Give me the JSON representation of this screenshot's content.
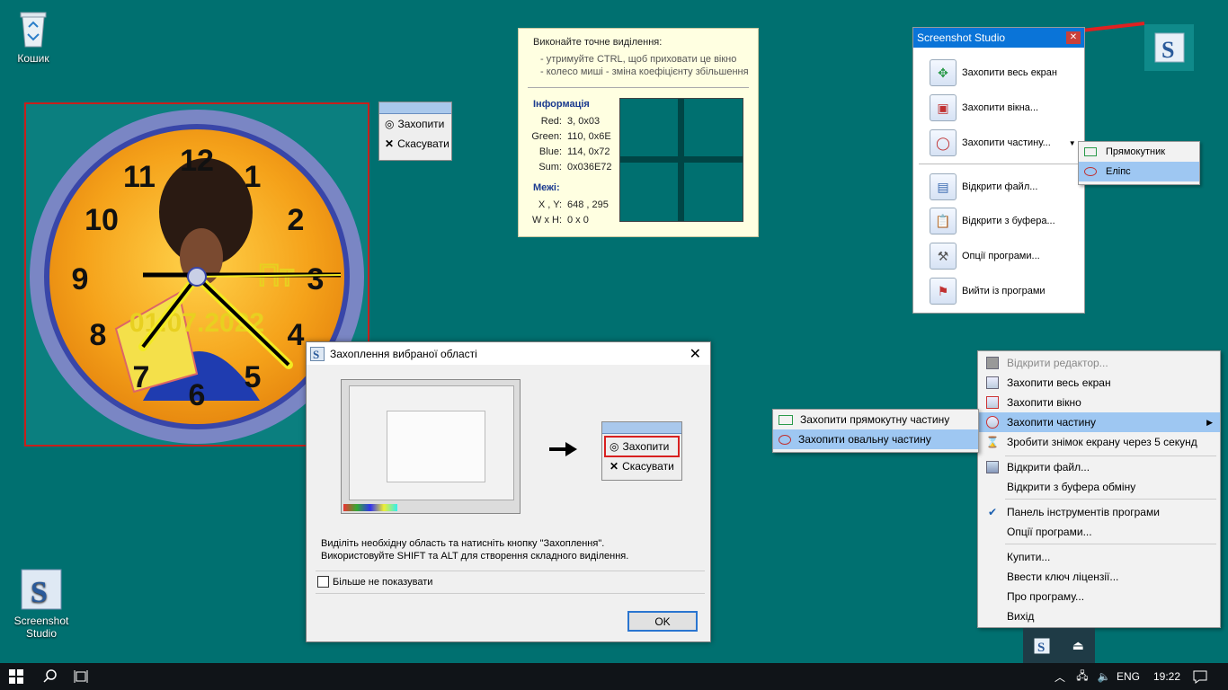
{
  "desktop": {
    "recycle_bin_label": "Кошик",
    "screenshot_studio_label_1": "Screenshot",
    "screenshot_studio_label_2": "Studio"
  },
  "clock": {
    "day": "Пт",
    "date": "01.07.2022",
    "numbers": [
      "12",
      "1",
      "2",
      "3",
      "4",
      "5",
      "6",
      "7",
      "8",
      "9",
      "10",
      "11"
    ]
  },
  "mini_panel": {
    "capture": "Захопити",
    "cancel": "Скасувати"
  },
  "info_panel": {
    "hint": "Виконайте точне виділення:",
    "sub1": "- утримуйте CTRL, щоб приховати це вікно",
    "sub2": "- колесо миші - зміна коефіцієнту збільшення",
    "info_header": "Інформація",
    "red_label": "Red:",
    "red_value": "3, 0x03",
    "green_label": "Green:",
    "green_value": "110, 0x6E",
    "blue_label": "Blue:",
    "blue_value": "114, 0x72",
    "sum_label": "Sum:",
    "sum_value": "0x036E72",
    "bounds_header": "Межі:",
    "xy_label": "X , Y:",
    "xy_value": "648 , 295",
    "wh_label": "W x H:",
    "wh_value": "0 x 0"
  },
  "ss_panel": {
    "title": "Screenshot Studio",
    "items": [
      {
        "label": "Захопити весь екран"
      },
      {
        "label": "Захопити вікна..."
      },
      {
        "label": "Захопити частину..."
      },
      {
        "label": "Відкрити файл..."
      },
      {
        "label": "Відкрити з буфера..."
      },
      {
        "label": "Опції програми..."
      },
      {
        "label": "Вийти із програми"
      }
    ],
    "submenu": [
      "Прямокутник",
      "Еліпс"
    ]
  },
  "dialog": {
    "title": "Захоплення вибраної області",
    "capture": "Захопити",
    "cancel": "Скасувати",
    "desc1": "Виділіть необхідну область та натисніть кнопку \"Захоплення\".",
    "desc2": "Використовуйте SHIFT та ALT для створення складного виділення.",
    "checkbox": "Більше не показувати",
    "ok": "OK"
  },
  "context_menu": {
    "items": [
      {
        "label": "Відкрити редактор..."
      },
      {
        "label": "Захопити весь екран"
      },
      {
        "label": "Захопити вікно"
      },
      {
        "label": "Захопити частину"
      },
      {
        "label": "Зробити знімок екрану через 5 секунд"
      },
      {
        "label": "Відкрити файл..."
      },
      {
        "label": "Відкрити з буфера обміну"
      },
      {
        "label": "Панель інструментів програми"
      },
      {
        "label": "Опції програми..."
      },
      {
        "label": "Купити..."
      },
      {
        "label": "Ввести ключ ліцензії..."
      },
      {
        "label": "Про програму..."
      },
      {
        "label": "Вихід"
      }
    ],
    "submenu": [
      "Захопити прямокутну частину",
      "Захопити овальну частину"
    ]
  },
  "taskbar": {
    "lang": "ENG",
    "time": "19:22"
  },
  "colors": {
    "desktop": "#007070",
    "accent": "#0a74d8",
    "selection": "#9ec7f2",
    "highlight_border": "#d82020"
  }
}
